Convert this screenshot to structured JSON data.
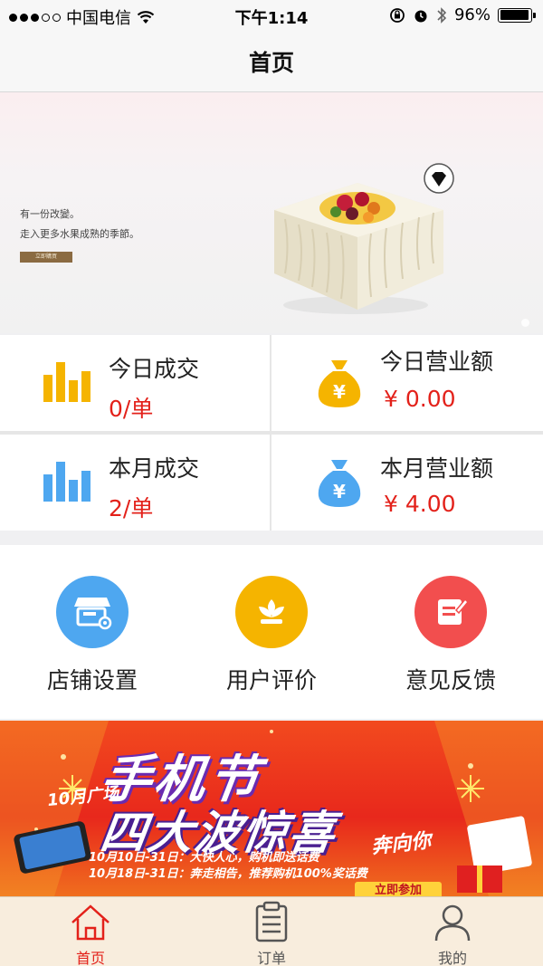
{
  "status_bar": {
    "carrier": "中国电信",
    "time": "下午1:14",
    "battery": "96%",
    "battery_level": 0.96
  },
  "nav": {
    "title": "首页"
  },
  "banner": {
    "line1": "有一份改變。",
    "line2": "走入更多水果成熟的季節。",
    "button_label": "立即購買"
  },
  "stats": [
    {
      "label": "今日成交",
      "value": "0/单",
      "icon": "bar-chart-icon",
      "color": "#f5b400"
    },
    {
      "label": "今日营业额",
      "value": "¥ 0.00",
      "icon": "money-bag-icon",
      "color": "#f5b400"
    },
    {
      "label": "本月成交",
      "value": "2/单",
      "icon": "bar-chart-icon",
      "color": "#4ea7f0"
    },
    {
      "label": "本月营业额",
      "value": "¥ 4.00",
      "icon": "money-bag-icon",
      "color": "#4ea7f0"
    }
  ],
  "actions": [
    {
      "label": "店铺设置",
      "icon": "shop-settings-icon",
      "color": "#4ea7f0"
    },
    {
      "label": "用户评价",
      "icon": "flower-icon",
      "color": "#f5b400"
    },
    {
      "label": "意见反馈",
      "icon": "feedback-icon",
      "color": "#f24e4e"
    }
  ],
  "promo": {
    "month_label": "10月广场",
    "title": "手机节",
    "subtitle": "四大波惊喜",
    "tagline": "奔向你",
    "line1": "10月10日-31日：大快人心，购机即送话费",
    "line2": "10月18日-31日：奔走相告，推荐购机100%奖话费",
    "cta": "立即参加"
  },
  "tabbar": {
    "tabs": [
      {
        "label": "首页",
        "icon": "home-icon",
        "active": true
      },
      {
        "label": "订单",
        "icon": "order-list-icon",
        "active": false
      },
      {
        "label": "我的",
        "icon": "user-icon",
        "active": false
      }
    ]
  },
  "colors": {
    "accent": "#e3211a",
    "yellow": "#f5b400",
    "blue": "#4ea7f0",
    "red": "#f24e4e"
  }
}
